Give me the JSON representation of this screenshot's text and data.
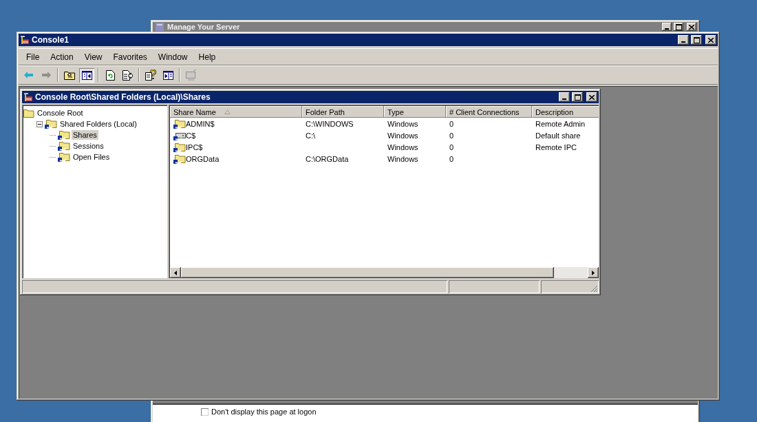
{
  "background_window": {
    "title": "Manage Your Server",
    "checkbox": {
      "label": "Don't display this page at logon",
      "checked": false
    }
  },
  "window": {
    "title": "Console1",
    "menu": [
      {
        "label": "File"
      },
      {
        "label": "Action"
      },
      {
        "label": "View"
      },
      {
        "label": "Favorites"
      },
      {
        "label": "Window"
      },
      {
        "label": "Help"
      }
    ],
    "toolbar": [
      {
        "kind": "back",
        "disabled": false,
        "pressed": false
      },
      {
        "kind": "forward",
        "disabled": true,
        "pressed": false
      },
      {
        "kind": "separator"
      },
      {
        "kind": "up",
        "disabled": false,
        "pressed": false
      },
      {
        "kind": "tree",
        "disabled": false,
        "pressed": true
      },
      {
        "kind": "separator"
      },
      {
        "kind": "refresh",
        "disabled": false,
        "pressed": false
      },
      {
        "kind": "export",
        "disabled": false,
        "pressed": false
      },
      {
        "kind": "separator"
      },
      {
        "kind": "help",
        "disabled": false,
        "pressed": false
      },
      {
        "kind": "pane",
        "disabled": false,
        "pressed": false
      },
      {
        "kind": "separator"
      },
      {
        "kind": "connect",
        "disabled": true,
        "pressed": false
      }
    ],
    "child_window": {
      "title": "Console Root\\Shared Folders (Local)\\Shares",
      "tree": [
        {
          "label": "Console Root",
          "kind": "folder",
          "selected": false,
          "children": [
            {
              "label": "Shared Folders (Local)",
              "kind": "share",
              "selected": false,
              "expanded": true,
              "children": [
                {
                  "label": "Shares",
                  "kind": "share",
                  "selected": true
                },
                {
                  "label": "Sessions",
                  "kind": "share",
                  "selected": false
                },
                {
                  "label": "Open Files",
                  "kind": "share",
                  "selected": false
                }
              ]
            }
          ]
        }
      ],
      "table": {
        "columns": [
          {
            "label": "Share Name",
            "sorted": true
          },
          {
            "label": "Folder Path",
            "sorted": false
          },
          {
            "label": "Type",
            "sorted": false
          },
          {
            "label": "# Client Connections",
            "sorted": false
          },
          {
            "label": "Description",
            "sorted": false
          }
        ],
        "rows": [
          {
            "kind": "folder",
            "cells": [
              "ADMIN$",
              "C:\\WINDOWS",
              "Windows",
              "0",
              "Remote Admin"
            ]
          },
          {
            "kind": "drive",
            "cells": [
              "C$",
              "C:\\",
              "Windows",
              "0",
              "Default share"
            ]
          },
          {
            "kind": "folder",
            "cells": [
              "IPC$",
              "",
              "Windows",
              "0",
              "Remote IPC"
            ]
          },
          {
            "kind": "folder",
            "cells": [
              "ORGData",
              "C:\\ORGData",
              "Windows",
              "0",
              ""
            ]
          }
        ]
      }
    }
  }
}
